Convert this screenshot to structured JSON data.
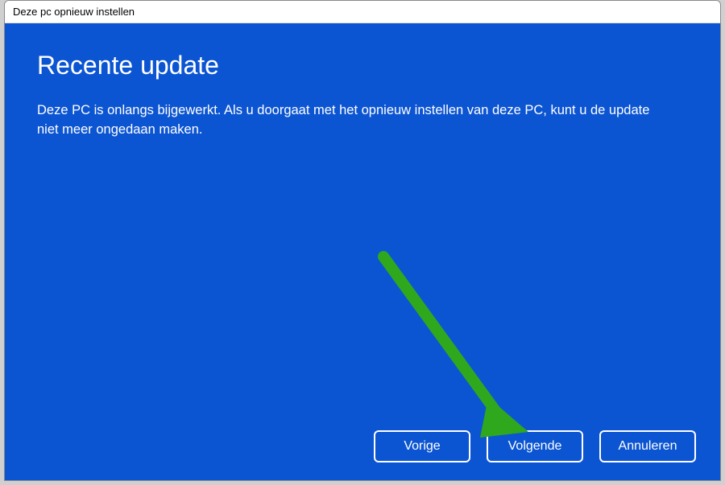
{
  "window": {
    "title": "Deze pc opnieuw instellen"
  },
  "dialog": {
    "heading": "Recente update",
    "message": "Deze PC is onlangs bijgewerkt. Als u doorgaat met het opnieuw instellen van deze PC, kunt u de update niet meer ongedaan maken."
  },
  "buttons": {
    "back": "Vorige",
    "next": "Volgende",
    "cancel": "Annuleren"
  },
  "annotation": {
    "arrow_color": "#2fa81e",
    "target": "next-button"
  }
}
